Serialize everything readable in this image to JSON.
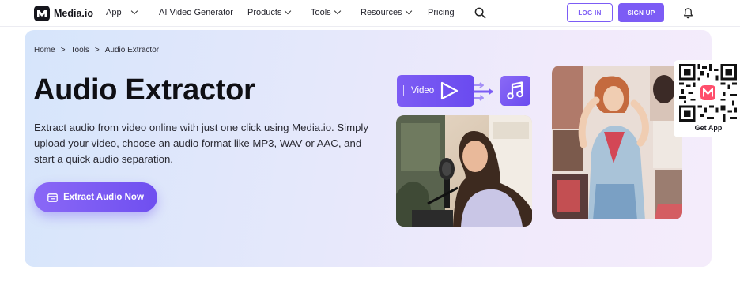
{
  "nav": {
    "brand": "Media.io",
    "items": [
      {
        "label": "App",
        "has_chevron": true
      },
      {
        "label": "AI Video Generator",
        "has_chevron": false
      },
      {
        "label": "Products",
        "has_chevron": true
      },
      {
        "label": "Tools",
        "has_chevron": true
      },
      {
        "label": "Resources",
        "has_chevron": true
      },
      {
        "label": "Pricing",
        "has_chevron": false
      }
    ],
    "login_label": "LOG IN",
    "signup_label": "SIGN UP"
  },
  "breadcrumb": [
    "Home",
    ">",
    "Tools",
    ">",
    "Audio Extractor"
  ],
  "hero": {
    "title": "Audio Extractor",
    "description": "Extract audio from video online with just one click using Media.io. Simply upload your video, choose an audio format like MP3, WAV or AAC, and start a quick audio separation.",
    "cta_label": "Extract Audio Now",
    "video_chip_label": "Video"
  },
  "qr": {
    "label": "Get App"
  },
  "colors": {
    "accent": "#7c5cf5",
    "hero_bg_start": "#d6e5fb",
    "hero_bg_end": "#f4ecfb"
  },
  "icons": [
    "logo-icon",
    "chevron-down-icon",
    "search-icon",
    "bell-icon",
    "upload-icon",
    "play-icon",
    "arrows-icon",
    "music-note-icon",
    "qr-code-icon"
  ]
}
